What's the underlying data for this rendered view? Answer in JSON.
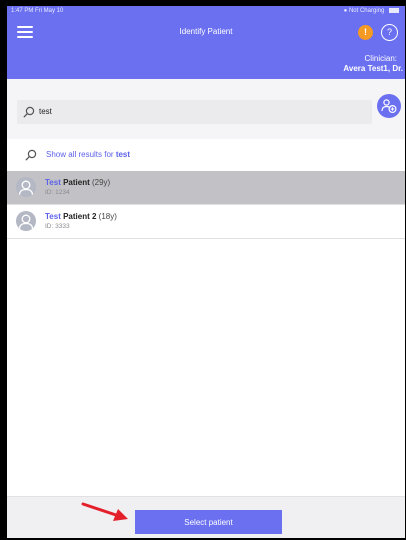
{
  "status_bar": {
    "time": "1:47 PM  Fri May 10",
    "charging": "Not Charging"
  },
  "header": {
    "title": "Identify Patient",
    "alert_glyph": "!",
    "help_glyph": "?",
    "clinician_label": "Clinician:",
    "clinician_name": "Avera Test1, Dr."
  },
  "search": {
    "value": "test",
    "placeholder": ""
  },
  "show_all": {
    "prefix": "Show all results for ",
    "term": "test"
  },
  "patients": [
    {
      "highlight": "Test",
      "rest": " Patient",
      "age": " (29y)",
      "id": "ID: 1234",
      "selected": true
    },
    {
      "highlight": "Test",
      "rest": " Patient 2",
      "age": " (18y)",
      "id": "ID: 3333",
      "selected": false
    }
  ],
  "footer": {
    "select_label": "Select patient"
  },
  "colors": {
    "accent": "#6b70f0",
    "selected_row": "#c2c2c6",
    "alert": "#f59a22",
    "annotation_arrow": "#e3202a"
  }
}
